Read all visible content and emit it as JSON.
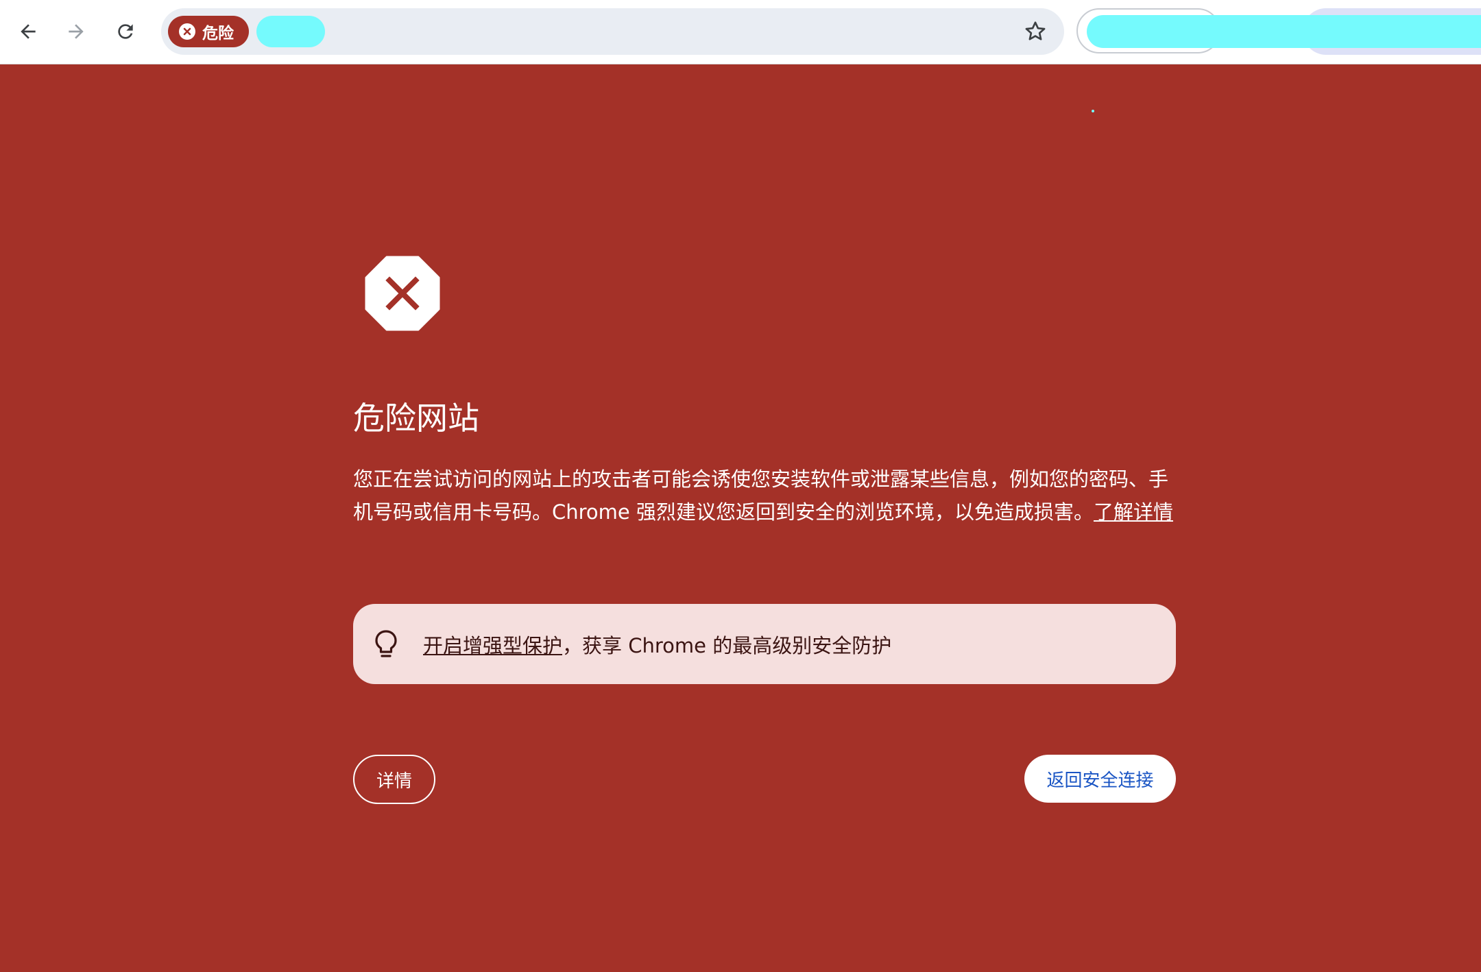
{
  "browser": {
    "security_chip": {
      "label": "危险",
      "icon": "error-circle-icon",
      "color": "#a43128"
    },
    "url_redacted": true,
    "nav_icons": [
      "back-arrow-icon",
      "forward-arrow-icon",
      "reload-icon"
    ],
    "bookmark_icon": "star-icon"
  },
  "interstitial": {
    "background_color": "#a43128",
    "icon": "stop-sign-x-icon",
    "heading": "危险网站",
    "body": "您正在尝试访问的网站上的攻击者可能会诱使您安装软件或泄露某些信息，例如您的密码、手机号码或信用卡号码。Chrome 强烈建议您返回到安全的浏览环境，以免造成损害。",
    "learn_more": "了解详情",
    "promo": {
      "icon": "lightbulb-icon",
      "link_text": "开启增强型保护",
      "text": "，获享 Chrome 的最高级别安全防护"
    },
    "details_button": "详情",
    "back_to_safety_button": "返回安全连接",
    "accent_color": "#1a55c4"
  }
}
